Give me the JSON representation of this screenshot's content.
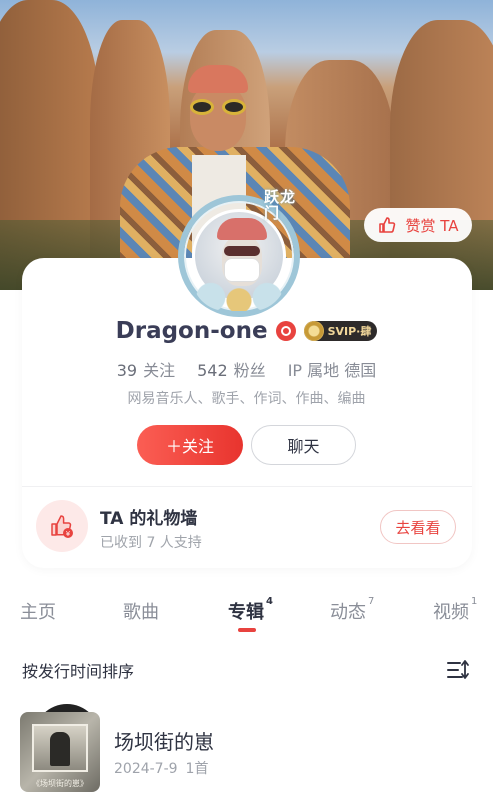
{
  "profile": {
    "reward_label": "赞赏 TA",
    "frame_text": "跃龙门",
    "name": "Dragon-one",
    "svip_label": "SVIP·肆",
    "following_count": "39",
    "following_label": "关注",
    "followers_count": "542",
    "followers_label": "粉丝",
    "ip_label": "IP 属地 德国",
    "bio": "网易音乐人、歌手、作词、作曲、编曲",
    "follow_label": "＋关注",
    "chat_label": "聊天"
  },
  "gift_wall": {
    "title": "TA 的礼物墙",
    "subtitle": "已收到 7 人支持",
    "button_label": "去看看"
  },
  "tabs": [
    {
      "label": "主页",
      "count": ""
    },
    {
      "label": "歌曲",
      "count": ""
    },
    {
      "label": "专辑",
      "count": "4"
    },
    {
      "label": "动态",
      "count": "7"
    },
    {
      "label": "视频",
      "count": "1"
    }
  ],
  "active_tab": "专辑",
  "sort": {
    "label": "按发行时间排序",
    "icon": "sort-icon"
  },
  "albums": [
    {
      "title": "场坝街的崽",
      "date": "2024-7-9",
      "tracks": "1首",
      "cover_caption": "《场坝街的崽》"
    }
  ],
  "colors": {
    "accent": "#e8433f",
    "text_primary": "#2f3342",
    "text_secondary": "#9fa3ab"
  }
}
